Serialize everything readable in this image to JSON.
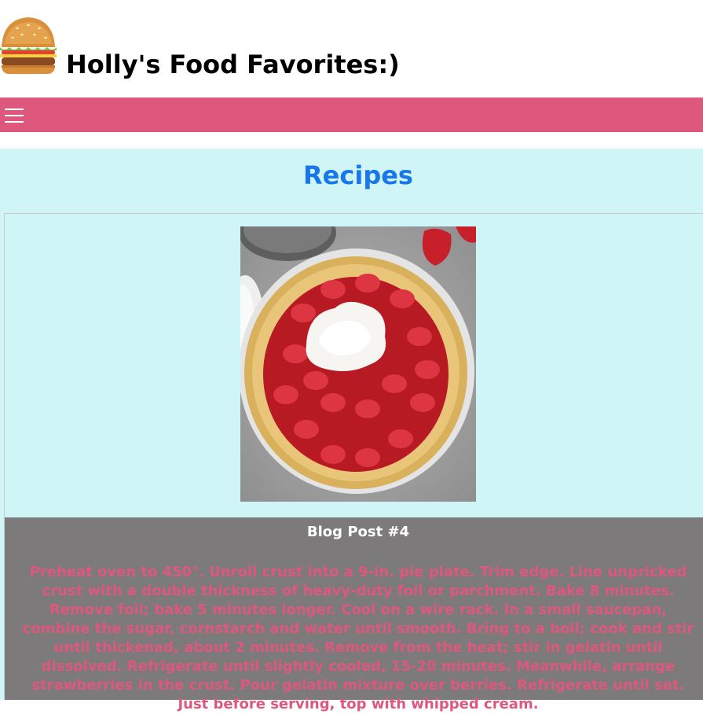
{
  "header": {
    "logo_icon": "burger-icon",
    "title": "Holly's Food Favorites:)"
  },
  "navbar": {
    "menu_icon": "hamburger-menu-icon",
    "color": "#de587e"
  },
  "main": {
    "section_title": "Recipes",
    "background_color": "#d0f5f6"
  },
  "post": {
    "image_alt": "strawberry-pie-photo",
    "title": "Blog Post #4",
    "body": "Preheat oven to 450°. Unroll crust into a 9-in. pie plate. Trim edge. Line unpricked crust with a double thickness of heavy-duty foil or parchment. Bake 8 minutes. Remove foil; bake 5 minutes longer. Cool on a wire rack. In a small saucepan, combine the sugar, cornstarch and water until smooth. Bring to a boil; cook and stir until thickened, about 2 minutes. Remove from the heat; stir in gelatin until dissolved. Refrigerate until slightly cooled, 15-20 minutes. Meanwhile, arrange strawberries in the crust. Pour gelatin mixture over berries. Refrigerate until set. Just before serving, top with whipped cream.",
    "body_color": "#de587e",
    "card_body_color": "#7d7a7b"
  }
}
